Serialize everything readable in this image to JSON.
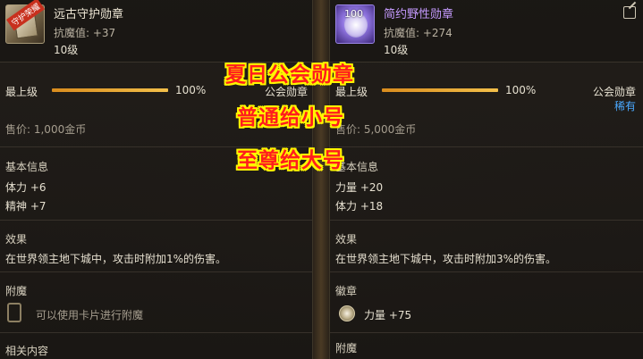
{
  "overlay": {
    "line1": "夏日公会勋章",
    "line2": "普通给小号",
    "line3": "至尊给大号"
  },
  "left": {
    "icon_badge": "守护荣耀",
    "title": "远古守护勋章",
    "stat": "抗魔值: +37",
    "level": "10级",
    "max_level_label": "最上级",
    "max_level_percent": "100%",
    "progress": 1.0,
    "category": "公会勋章",
    "price": "售价: 1,000金币",
    "basic_info_title": "基本信息",
    "basic_stats": [
      "体力 +6",
      "精神 +7"
    ],
    "effect_title": "效果",
    "effect_text": "在世界领主地下城中，攻击时附加1%的伤害。",
    "enchant_title": "附魔",
    "enchant_text": "可以使用卡片进行附魔",
    "related_title": "相关内容"
  },
  "right": {
    "icon_num": "100",
    "title": "简约野性勋章",
    "stat": "抗魔值: +274",
    "level": "10级",
    "max_level_label": "最上级",
    "max_level_percent": "100%",
    "progress": 1.0,
    "category": "公会勋章",
    "rarity": "稀有",
    "price": "售价: 5,000金币",
    "basic_info_title": "基本信息",
    "basic_stats": [
      "力量 +20",
      "体力 +18"
    ],
    "effect_title": "效果",
    "effect_text": "在世界领主地下城中，攻击时附加3%的伤害。",
    "emblem_title": "徽章",
    "emblem_stat": "力量 +75",
    "enchant_title": "附魔"
  },
  "colors": {
    "title_purple": "#c59bff",
    "rare_blue": "#4aa9ff",
    "bar_orange": "#f0a830",
    "overlay_red": "#ff1d1d",
    "overlay_outline": "#fff600"
  }
}
